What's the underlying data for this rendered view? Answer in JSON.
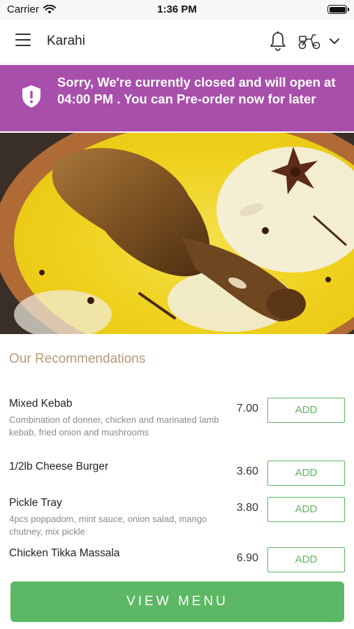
{
  "status_bar": {
    "carrier": "Carrier",
    "time": "1:36 PM",
    "wifi_icon": "wifi-icon",
    "battery_icon": "battery-icon"
  },
  "header": {
    "title": "Karahi",
    "menu_icon": "hamburger-menu-icon",
    "bell_icon": "bell-icon",
    "delivery_icon": "scooter-icon",
    "dropdown_icon": "chevron-down-icon"
  },
  "banner": {
    "message": "Sorry, We're currently closed and will open at 04:00 PM . You can Pre-order now for later",
    "icon": "shield-alert-icon",
    "background": "#a84fac"
  },
  "hero": {
    "image": "chicken-biryani-photo"
  },
  "recommendations": {
    "title": "Our Recommendations",
    "items": [
      {
        "name": "Mixed Kebab",
        "description": "Combination of donner, chicken and marinated lamb kebab, fried onion and mushrooms",
        "price": "7.00",
        "add_label": "ADD"
      },
      {
        "name": "1/2lb  Cheese Burger",
        "description": "",
        "price": "3.60",
        "add_label": "ADD"
      },
      {
        "name": "Pickle Tray",
        "description": "4pcs poppadom, mint sauce, onion salad, mango chutney, mix pickle",
        "price": "3.80",
        "add_label": "ADD"
      },
      {
        "name": "Chicken Tikka Massala",
        "description": "",
        "price": "6.90",
        "add_label": "ADD"
      }
    ]
  },
  "footer": {
    "view_menu_label": "VIEW MENU"
  },
  "colors": {
    "accent_green": "#5cb85c",
    "banner_purple": "#a84fac",
    "section_title": "#b49a74"
  }
}
